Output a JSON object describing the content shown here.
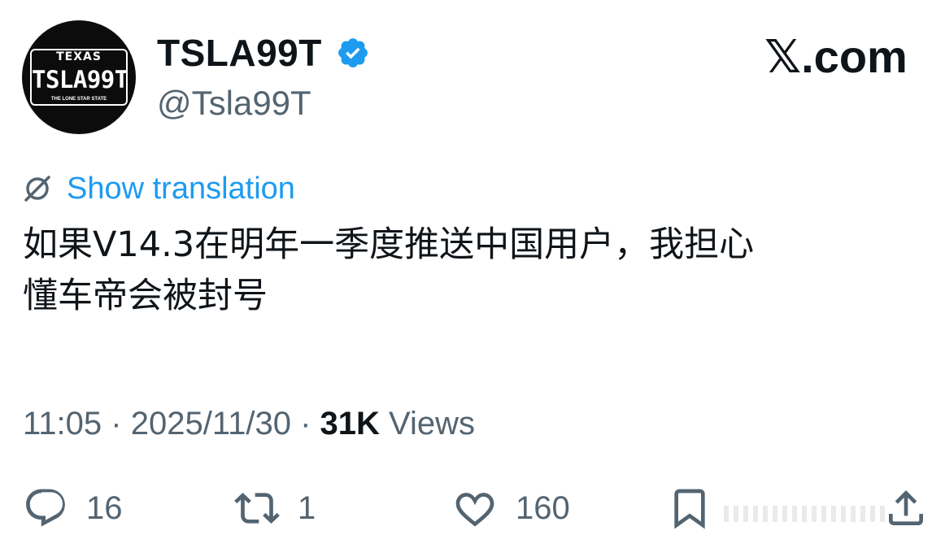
{
  "author": {
    "display_name": "TSLA99T",
    "handle": "@Tsla99T",
    "avatar_plate": {
      "state": "TEXAS",
      "number": "TSLA99T",
      "slogan": "THE LONE STAR STATE"
    },
    "verified_icon": "verified-badge-icon"
  },
  "brand": {
    "label": "𝕏.com"
  },
  "translation": {
    "label": "Show translation",
    "icon": "translate-globe-icon"
  },
  "tweet": {
    "text_line1": "如果V14.3在明年一季度推送中国用户，我担心",
    "text_line2": "懂车帝会被封号"
  },
  "meta": {
    "time": "11:05",
    "date": "2025/11/30",
    "views_count": "31K",
    "views_label": "Views",
    "separator": "·"
  },
  "actions": {
    "reply_count": "16",
    "repost_count": "1",
    "like_count": "160"
  },
  "colors": {
    "accent": "#1d9bf0",
    "text_primary": "#0f1419",
    "text_secondary": "#536471"
  }
}
